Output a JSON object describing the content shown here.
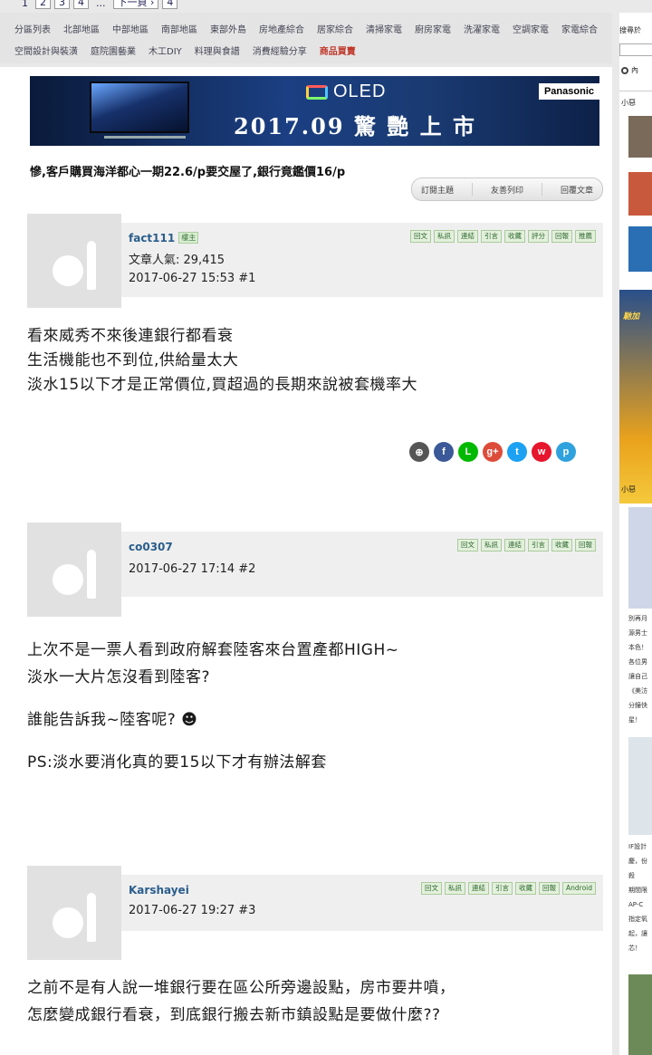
{
  "pager": {
    "pages": [
      "1",
      "2",
      "3",
      "4",
      "...",
      "下一頁 ›",
      "4"
    ]
  },
  "forum_nav": {
    "items": [
      "分區列表",
      "北部地區",
      "中部地區",
      "南部地區",
      "東部外島",
      "房地產綜合",
      "居家綜合",
      "清掃家電",
      "廚房家電",
      "洗濯家電",
      "空調家電",
      "家電綜合",
      "空間設計與裝潢",
      "庭院園藝業",
      "木工DIY",
      "料理與食譜",
      "消費經驗分享"
    ],
    "hot_item": "商品買賣"
  },
  "banner": {
    "product": "OLED",
    "headline": "2017.09 驚 艷 上 市",
    "brand": "Panasonic"
  },
  "thread": {
    "title": "慘,客戶購買海洋都心一期22.6/p要交屋了,銀行竟鑑價16/p"
  },
  "thread_actions": [
    "訂閱主題",
    "友善列印",
    "回覆文章"
  ],
  "posts": [
    {
      "username": "fact111",
      "role": "樓主",
      "popularity": "文章人氣: 29,415",
      "datetime": "2017-06-27 15:53  #1",
      "tools": [
        "回文",
        "私訊",
        "連結",
        "引言",
        "收藏",
        "評分",
        "回報",
        "推薦"
      ],
      "lines": [
        "看來威秀不來後連銀行都看衰",
        "生活機能也不到位,供給量太大",
        "淡水15以下才是正常價位,買超過的長期來說被套機率大"
      ]
    },
    {
      "username": "co0307",
      "datetime": "2017-06-27 17:14  #2",
      "tools": [
        "回文",
        "私訊",
        "連結",
        "引言",
        "收藏",
        "回報"
      ],
      "lines": [
        "上次不是一票人看到政府解套陸客來台置產都HIGH~",
        "淡水一大片怎沒看到陸客?",
        "",
        "誰能告訴我~陸客呢? ☻",
        "",
        "PS:淡水要消化真的要15以下才有辦法解套"
      ]
    },
    {
      "username": "Karshayei",
      "datetime": "2017-06-27 19:27  #3",
      "tools": [
        "回文",
        "私訊",
        "連結",
        "引言",
        "收藏",
        "回報",
        "Android"
      ],
      "lines": [
        "之前不是有人說一堆銀行要在區公所旁邊設點，房市要井噴，",
        "怎麼變成銀行看衰，到底銀行搬去新市鎮設點是要做什麼??"
      ]
    }
  ],
  "share_icons": [
    {
      "name": "fb-icon",
      "glyph": "f",
      "color": "#3b5998"
    },
    {
      "name": "line-icon",
      "glyph": "L",
      "color": "#00b900"
    },
    {
      "name": "google-plus-icon",
      "glyph": "g+",
      "color": "#dd4b39"
    },
    {
      "name": "twitter-icon",
      "glyph": "t",
      "color": "#1da1f2"
    },
    {
      "name": "weibo-icon",
      "glyph": "w",
      "color": "#e6162d"
    },
    {
      "name": "plurk-icon",
      "glyph": "p",
      "color": "#2fa2de"
    }
  ],
  "sidebar": {
    "search_label": "搜尋於",
    "radio_label": "內",
    "section1": "小惡",
    "section2": "小惡",
    "promo_lines": [
      "別再月",
      "源男士",
      "本色！",
      "各位男",
      "讓自己",
      "《美汸",
      "分鐘快",
      "星！"
    ],
    "promo2_lines": [
      "IF設計",
      "慶，份",
      "殺",
      "期間限",
      "AP-C",
      "指定氧",
      "起，讓",
      "芯！"
    ],
    "ad_text": "馳加"
  }
}
